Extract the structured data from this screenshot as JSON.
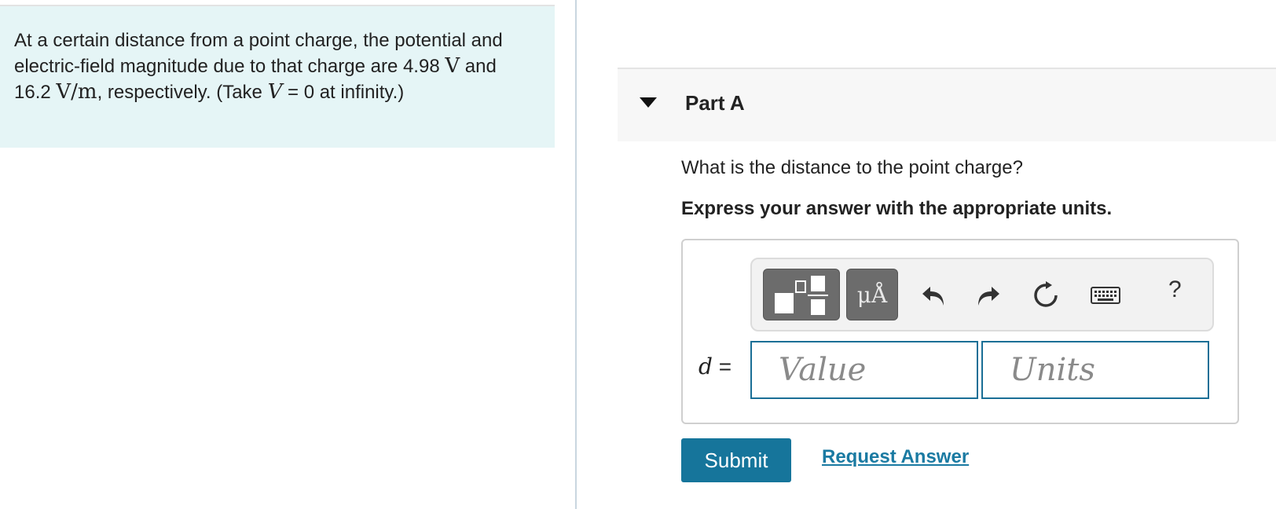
{
  "problem": {
    "text_1": "At a certain distance from a point charge, the potential and electric-field magnitude due to that charge are 4.98 ",
    "unit_V": "V",
    "text_2": " and 16.2 ",
    "unit_Vm": "V/m",
    "text_3": ", respectively. (Take ",
    "var_V": "V",
    "text_4": " = 0 at infinity.)"
  },
  "part": {
    "title": "Part A",
    "question": "What is the distance to the point charge?",
    "instruction": "Express your answer with the appropriate units."
  },
  "toolbar": {
    "units_button_label": "μÅ",
    "help_label": "?",
    "icons": [
      "templates-icon",
      "units-icon",
      "undo-icon",
      "redo-icon",
      "reset-icon",
      "keyboard-icon",
      "help-icon"
    ]
  },
  "answer": {
    "variable": "d",
    "equals": " =",
    "value_placeholder": "Value",
    "units_placeholder": "Units"
  },
  "actions": {
    "submit_label": "Submit",
    "request_answer_label": "Request Answer"
  },
  "colors": {
    "problem_bg": "#e5f5f6",
    "accent": "#16759b",
    "link": "#1a7aa2",
    "field_border": "#1a6f96"
  }
}
